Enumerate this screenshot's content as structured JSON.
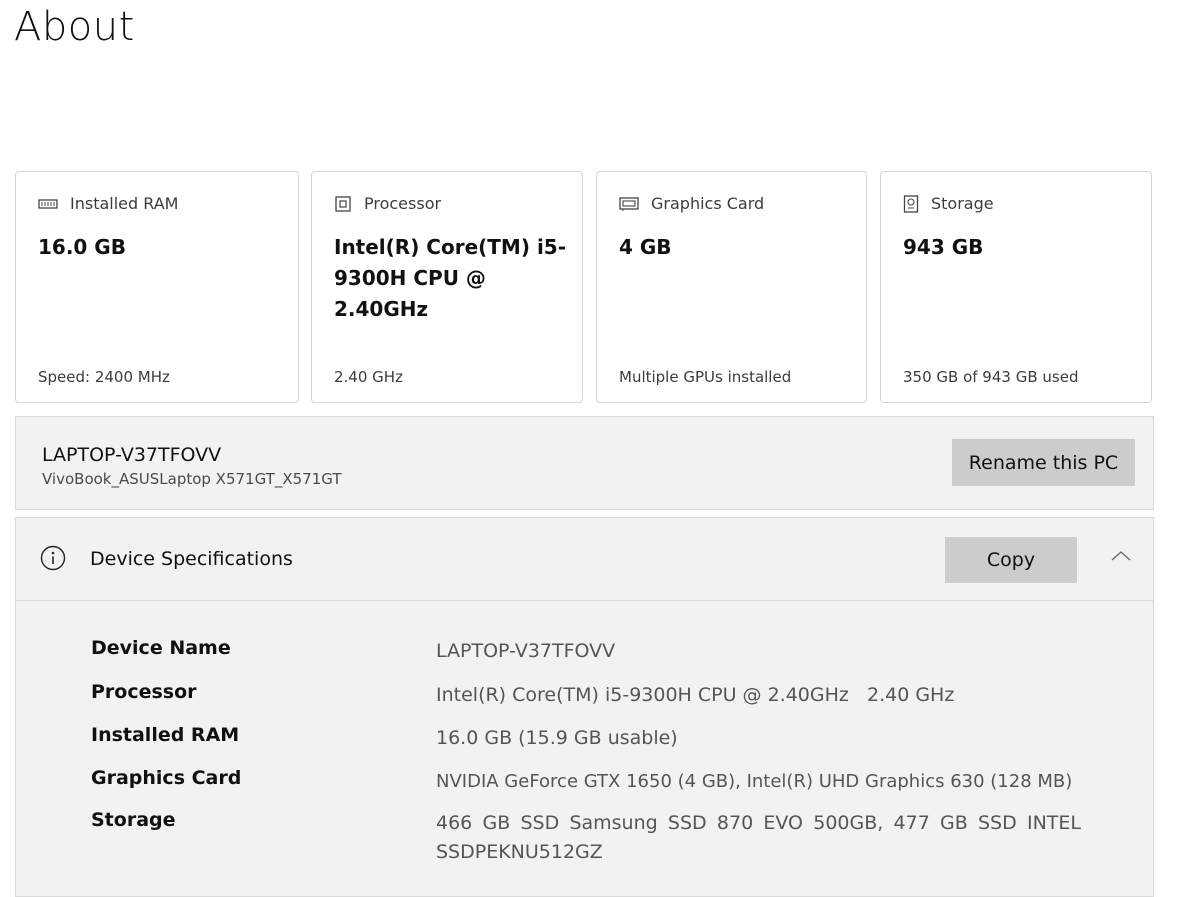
{
  "page_title": "About",
  "cards": [
    {
      "icon": "memory-icon",
      "label": "Installed RAM",
      "value": "16.0 GB",
      "sub": "Speed: 2400 MHz"
    },
    {
      "icon": "processor-icon",
      "label": "Processor",
      "value": "Intel(R) Core(TM) i5-9300H CPU @ 2.40GHz",
      "sub": "2.40 GHz"
    },
    {
      "icon": "graphics-card-icon",
      "label": "Graphics Card",
      "value": "4 GB",
      "sub": "Multiple GPUs installed"
    },
    {
      "icon": "storage-icon",
      "label": "Storage",
      "value": "943 GB",
      "sub": "350 GB of 943 GB used"
    }
  ],
  "pc": {
    "name": "LAPTOP-V37TFOVV",
    "model": "VivoBook_ASUSLaptop X571GT_X571GT",
    "rename_label": "Rename this PC"
  },
  "specs": {
    "title": "Device Specifications",
    "copy_label": "Copy",
    "rows": [
      {
        "label": "Device Name",
        "value": "LAPTOP-V37TFOVV"
      },
      {
        "label": "Processor",
        "value": "Intel(R) Core(TM) i5-9300H CPU @ 2.40GHz   2.40 GHz"
      },
      {
        "label": "Installed RAM",
        "value": "16.0 GB (15.9 GB usable)"
      },
      {
        "label": "Graphics Card",
        "value": "NVIDIA GeForce GTX 1650 (4 GB), Intel(R) UHD Graphics 630 (128 MB)"
      },
      {
        "label": "Storage",
        "value": "466 GB SSD Samsung SSD 870 EVO 500GB, 477 GB SSD INTEL SSDPEKNU512GZ"
      }
    ]
  }
}
